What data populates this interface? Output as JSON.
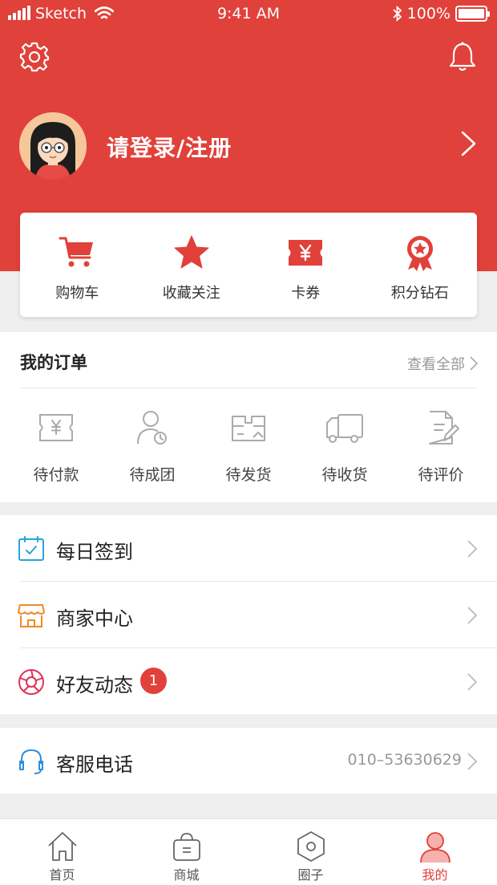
{
  "status_bar": {
    "carrier": "Sketch",
    "time": "9:41 AM",
    "battery": "100%"
  },
  "colors": {
    "brand": "#e0413a",
    "page_bg": "#efefef",
    "sign_in_icon": "#2aa3d8",
    "merchant_icon": "#f08a24",
    "friends_icon": "#e0315a",
    "service_icon": "#2a8ee0"
  },
  "header": {
    "icons": [
      "settings-icon",
      "bell-icon"
    ],
    "login_text": "请登录/注册"
  },
  "quick_links": [
    {
      "label": "购物车",
      "icon": "cart-icon"
    },
    {
      "label": "收藏关注",
      "icon": "star-icon"
    },
    {
      "label": "卡券",
      "icon": "coupon-icon"
    },
    {
      "label": "积分钻石",
      "icon": "medal-icon"
    }
  ],
  "orders": {
    "title": "我的订单",
    "view_all": "查看全部",
    "items": [
      {
        "label": "待付款",
        "icon": "payment-icon"
      },
      {
        "label": "待成团",
        "icon": "group-buy-icon"
      },
      {
        "label": "待发货",
        "icon": "package-icon"
      },
      {
        "label": "待收货",
        "icon": "truck-icon"
      },
      {
        "label": "待评价",
        "icon": "review-icon"
      }
    ]
  },
  "menu": [
    {
      "label": "每日签到",
      "icon": "calendar-check-icon"
    },
    {
      "label": "商家中心",
      "icon": "store-icon"
    },
    {
      "label": "好友动态",
      "icon": "aperture-icon",
      "badge": "1"
    }
  ],
  "service": {
    "label": "客服电话",
    "value": "010–53630629",
    "icon": "headset-icon"
  },
  "tabbar": [
    {
      "label": "首页",
      "icon": "home-icon",
      "active": false
    },
    {
      "label": "商城",
      "icon": "shopping-bag-icon",
      "active": false
    },
    {
      "label": "圈子",
      "icon": "hexagon-icon",
      "active": false
    },
    {
      "label": "我的",
      "icon": "user-icon",
      "active": true
    }
  ]
}
